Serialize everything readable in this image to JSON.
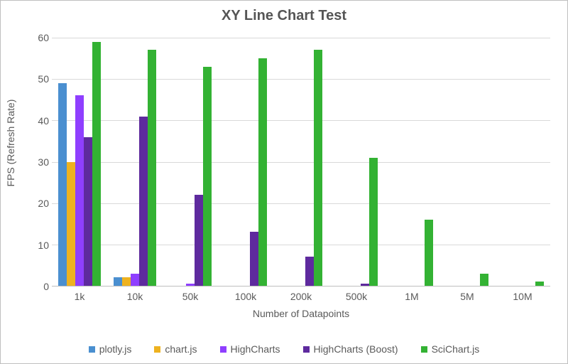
{
  "chart_data": {
    "type": "bar",
    "title": "XY Line Chart Test",
    "xlabel": "Number of Datapoints",
    "ylabel": "FPS (Refresh Rate)",
    "categories": [
      "1k",
      "10k",
      "50k",
      "100k",
      "200k",
      "500k",
      "1M",
      "5M",
      "10M"
    ],
    "ylim": [
      0,
      60
    ],
    "yticks": [
      0,
      10,
      20,
      30,
      40,
      50,
      60
    ],
    "series": [
      {
        "name": "plotly.js",
        "color": "#4a8fd0",
        "values": [
          49,
          2,
          0,
          0,
          0,
          0,
          0,
          0,
          0
        ]
      },
      {
        "name": "chart.js",
        "color": "#eeb220",
        "values": [
          30,
          2,
          0,
          0,
          0,
          0,
          0,
          0,
          0
        ]
      },
      {
        "name": "HighCharts",
        "color": "#8f3fff",
        "values": [
          46,
          3,
          0.5,
          0,
          0,
          0,
          0,
          0,
          0
        ]
      },
      {
        "name": "HighCharts (Boost)",
        "color": "#5e2a9e",
        "values": [
          36,
          41,
          22,
          13,
          7,
          0.5,
          0,
          0,
          0
        ]
      },
      {
        "name": "SciChart.js",
        "color": "#33b233",
        "values": [
          59,
          57,
          53,
          55,
          57,
          31,
          16,
          3,
          1
        ]
      }
    ]
  },
  "legend_items": [
    {
      "label": "plotly.js",
      "color": "#4a8fd0"
    },
    {
      "label": "chart.js",
      "color": "#eeb220"
    },
    {
      "label": "HighCharts",
      "color": "#8f3fff"
    },
    {
      "label": "HighCharts (Boost)",
      "color": "#5e2a9e"
    },
    {
      "label": "SciChart.js",
      "color": "#33b233"
    }
  ]
}
